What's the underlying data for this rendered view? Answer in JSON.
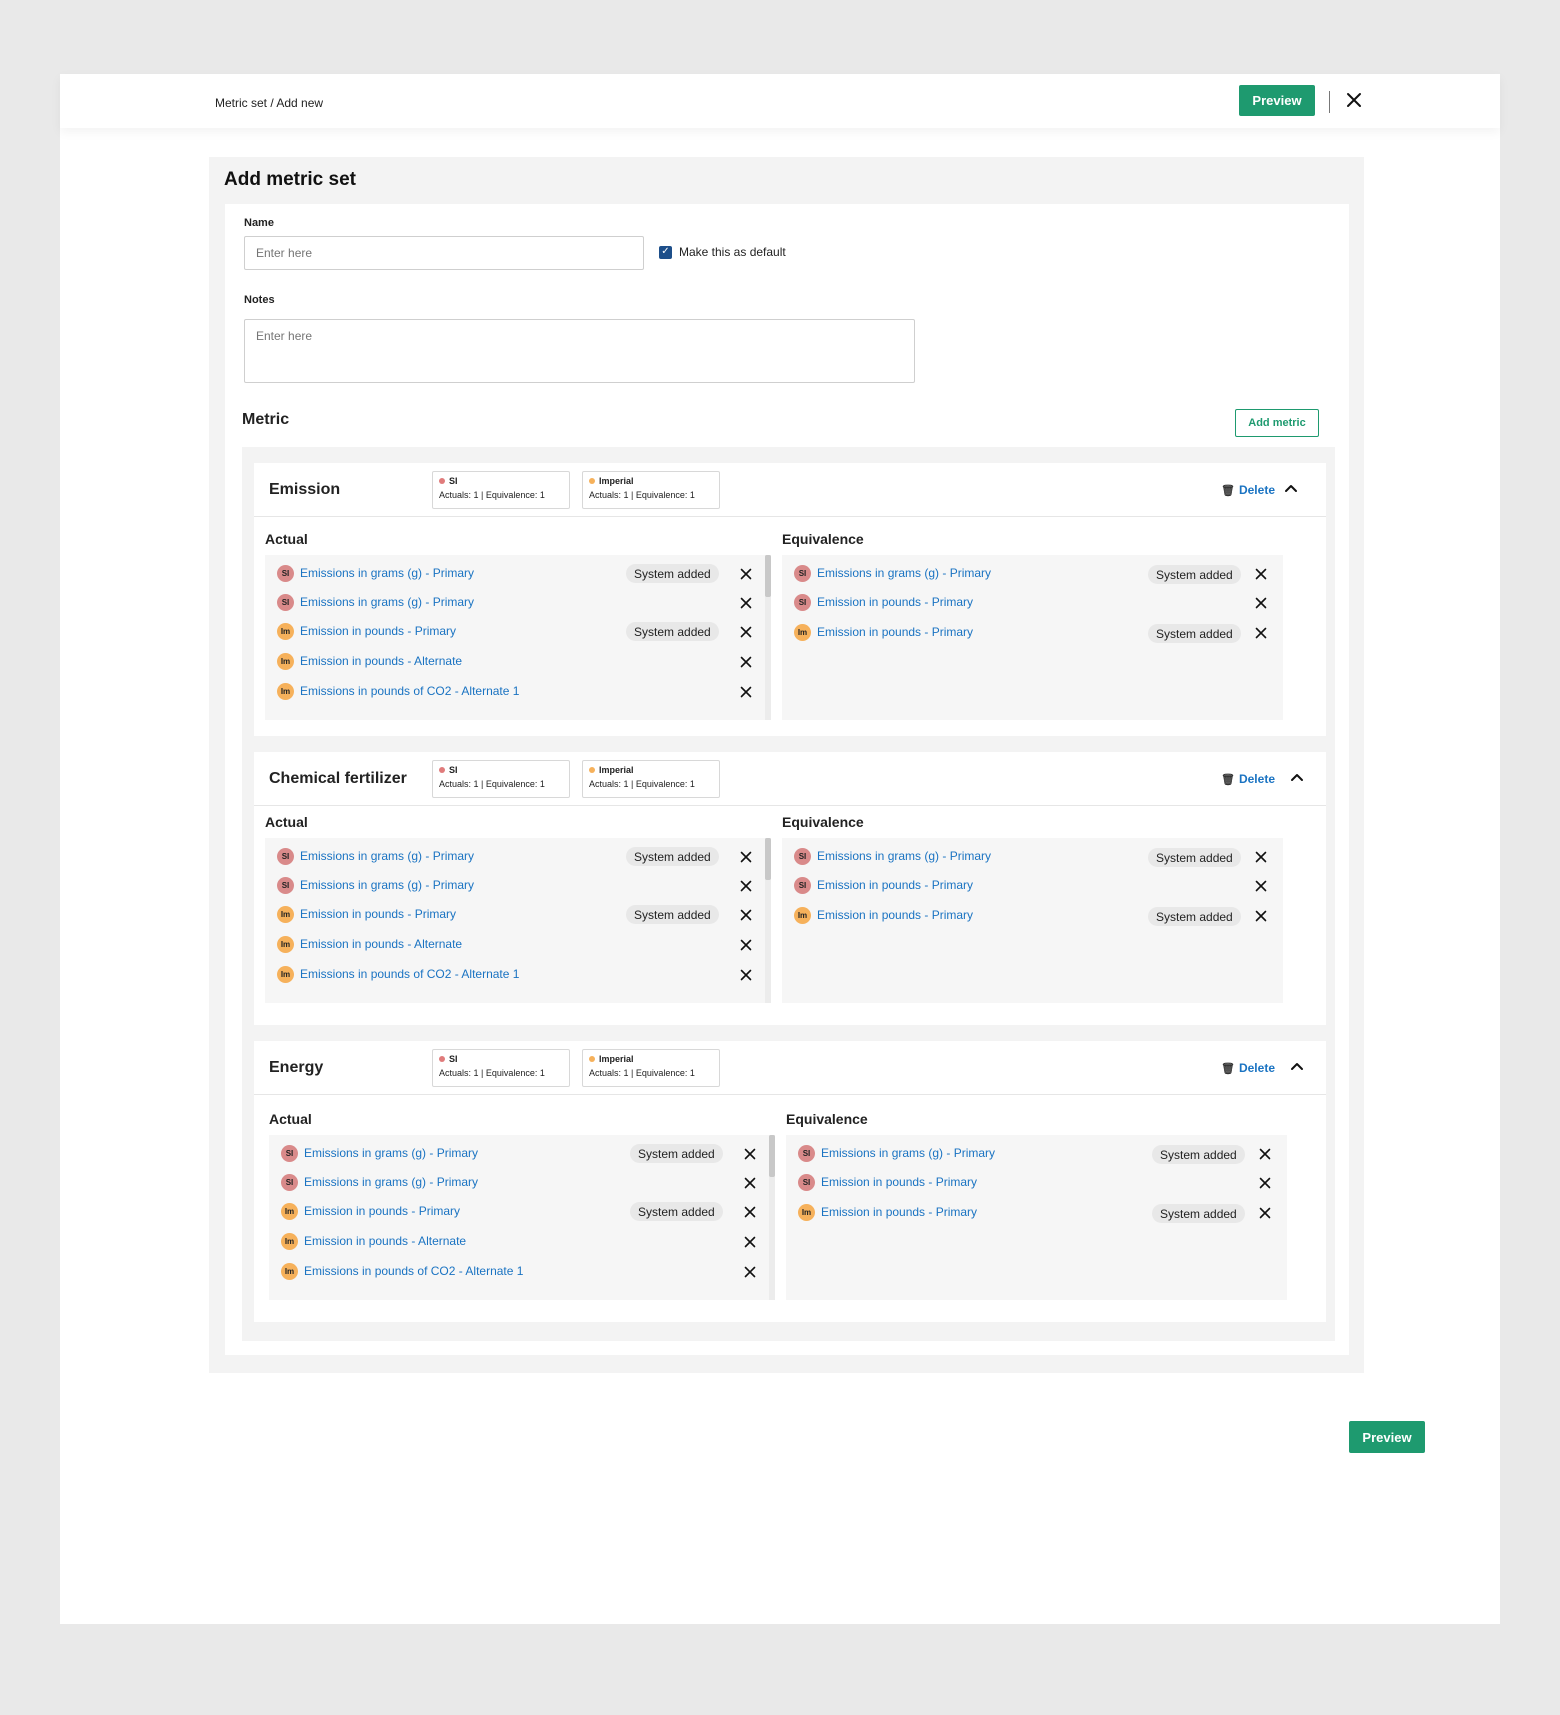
{
  "header": {
    "breadcrumb": "Metric set / Add new",
    "preview_label": "Preview",
    "close_icon": "×"
  },
  "page": {
    "title": "Add metric set",
    "name_label": "Name",
    "name_placeholder": "Enter here",
    "default_checkbox_label": "Make this as default",
    "default_checked": true,
    "notes_label": "Notes",
    "notes_placeholder": "Enter here",
    "metric_title": "Metric",
    "add_metric_label": "Add metric",
    "bottom_preview_label": "Preview"
  },
  "colors": {
    "primary_green": "#1e9a6f",
    "link_blue": "#1a73c2",
    "si_badge": "#d98a8a",
    "imperial_badge": "#f6b15b",
    "checkbox": "#1d4f8a"
  },
  "metric_groups": [
    {
      "name": "Emission",
      "units": [
        {
          "name": "SI",
          "dot": "#e07b7b",
          "counts": "Actuals: 1  |  Equivalence: 1"
        },
        {
          "name": "Imperial",
          "dot": "#f6b15b",
          "counts": "Actuals: 1  |  Equivalence: 1"
        }
      ],
      "delete_label": "Delete",
      "actual_title": "Actual",
      "equivalence_title": "Equivalence",
      "actual_items": [
        {
          "badge": "SI",
          "text": "Emissions in grams (g) - Primary",
          "tag": "System added"
        },
        {
          "badge": "SI",
          "text": "Emissions in grams (g) - Primary",
          "tag": ""
        },
        {
          "badge": "Im",
          "text": "Emission in pounds - Primary",
          "tag": "System added"
        },
        {
          "badge": "Im",
          "text": "Emission in pounds - Alternate",
          "tag": ""
        },
        {
          "badge": "Im",
          "text": "Emissions in pounds of CO2 - Alternate 1",
          "tag": ""
        }
      ],
      "equivalence_items": [
        {
          "badge": "SI",
          "text": "Emissions in grams (g) - Primary",
          "tag": "System added"
        },
        {
          "badge": "SI",
          "text": "Emission in pounds - Primary",
          "tag": ""
        },
        {
          "badge": "Im",
          "text": "Emission in pounds - Primary",
          "tag": "System added"
        }
      ]
    },
    {
      "name": "Chemical fertilizer",
      "units": [
        {
          "name": "SI",
          "dot": "#e07b7b",
          "counts": "Actuals: 1  |  Equivalence: 1"
        },
        {
          "name": "Imperial",
          "dot": "#f6b15b",
          "counts": "Actuals: 1  |  Equivalence: 1"
        }
      ],
      "delete_label": "Delete",
      "actual_title": "Actual",
      "equivalence_title": "Equivalence",
      "actual_items": [
        {
          "badge": "SI",
          "text": "Emissions in grams (g) - Primary",
          "tag": "System added"
        },
        {
          "badge": "SI",
          "text": "Emissions in grams (g) - Primary",
          "tag": ""
        },
        {
          "badge": "Im",
          "text": "Emission in pounds - Primary",
          "tag": "System added"
        },
        {
          "badge": "Im",
          "text": "Emission in pounds - Alternate",
          "tag": ""
        },
        {
          "badge": "Im",
          "text": "Emissions in pounds of CO2 - Alternate 1",
          "tag": ""
        }
      ],
      "equivalence_items": [
        {
          "badge": "SI",
          "text": "Emissions in grams (g) - Primary",
          "tag": "System added"
        },
        {
          "badge": "SI",
          "text": "Emission in pounds - Primary",
          "tag": ""
        },
        {
          "badge": "Im",
          "text": "Emission in pounds - Primary",
          "tag": "System added"
        }
      ]
    },
    {
      "name": "Energy",
      "units": [
        {
          "name": "SI",
          "dot": "#e07b7b",
          "counts": "Actuals: 1  |  Equivalence: 1"
        },
        {
          "name": "Imperial",
          "dot": "#f6b15b",
          "counts": "Actuals: 1  |  Equivalence: 1"
        }
      ],
      "delete_label": "Delete",
      "actual_title": "Actual",
      "equivalence_title": "Equivalence",
      "actual_items": [
        {
          "badge": "SI",
          "text": "Emissions in grams (g) - Primary",
          "tag": "System added"
        },
        {
          "badge": "SI",
          "text": "Emissions in grams (g) - Primary",
          "tag": ""
        },
        {
          "badge": "Im",
          "text": "Emission in pounds - Primary",
          "tag": "System added"
        },
        {
          "badge": "Im",
          "text": "Emission in pounds - Alternate",
          "tag": ""
        },
        {
          "badge": "Im",
          "text": "Emissions in pounds of CO2 - Alternate 1",
          "tag": ""
        }
      ],
      "equivalence_items": [
        {
          "badge": "SI",
          "text": "Emissions in grams (g) - Primary",
          "tag": "System added"
        },
        {
          "badge": "SI",
          "text": "Emission in pounds - Primary",
          "tag": ""
        },
        {
          "badge": "Im",
          "text": "Emission in pounds - Primary",
          "tag": "System added"
        }
      ]
    }
  ]
}
